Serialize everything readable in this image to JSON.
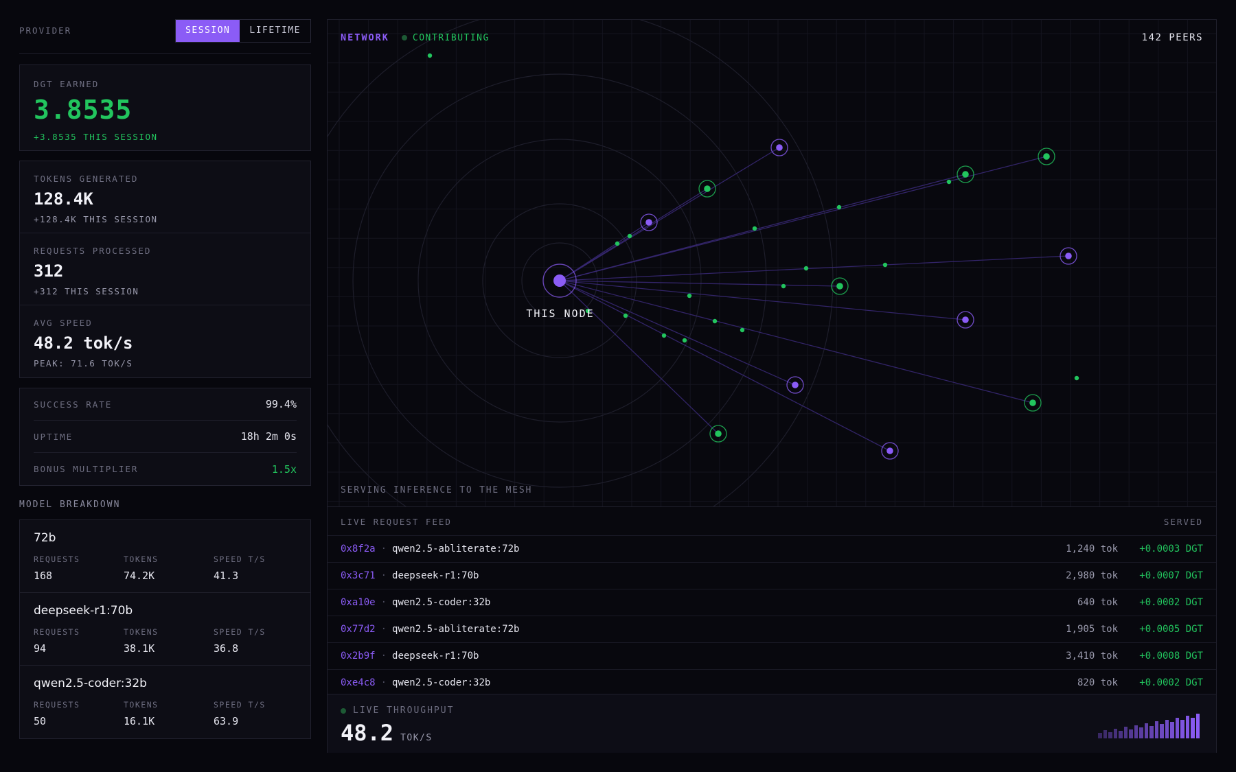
{
  "provider": {
    "label": "PROVIDER",
    "toggle": {
      "session": "SESSION",
      "lifetime": "LIFETIME"
    }
  },
  "earned": {
    "label": "DGT EARNED",
    "value": "3.8535",
    "session": "+3.8535 THIS SESSION"
  },
  "stats": [
    {
      "label": "TOKENS GENERATED",
      "value": "128.4K",
      "sub": "+128.4K THIS SESSION"
    },
    {
      "label": "REQUESTS PROCESSED",
      "value": "312",
      "sub": "+312 THIS SESSION"
    },
    {
      "label": "AVG SPEED",
      "value": "48.2 tok/s",
      "sub": "PEAK: 71.6 TOK/S"
    }
  ],
  "metrics": [
    {
      "label": "SUCCESS RATE",
      "value": "99.4%"
    },
    {
      "label": "UPTIME",
      "value": "18h 2m 0s"
    },
    {
      "label": "BONUS MULTIPLIER",
      "value": "1.5x"
    }
  ],
  "model_breakdown": {
    "title": "MODEL BREAKDOWN",
    "col_labels": {
      "requests": "REQUESTS",
      "tokens": "TOKENS",
      "speed": "SPEED T/S"
    },
    "models": [
      {
        "name": "72b",
        "requests": "168",
        "tokens": "74.2K",
        "speed": "41.3"
      },
      {
        "name": "deepseek-r1:70b",
        "requests": "94",
        "tokens": "38.1K",
        "speed": "36.8"
      },
      {
        "name": "qwen2.5-coder:32b",
        "requests": "50",
        "tokens": "16.1K",
        "speed": "63.9"
      }
    ]
  },
  "network": {
    "title": "NETWORK",
    "status": "CONTRIBUTING",
    "peers": "142 PEERS",
    "node_label": "THIS NODE",
    "footer": "SERVING INFERENCE TO THE MESH"
  },
  "feed": {
    "title": "LIVE REQUEST FEED",
    "served_label": "SERVED",
    "separator": "·",
    "rows": [
      {
        "id": "0x8f2a",
        "model": "qwen2.5-abliterate:72b",
        "tokens": "1,240 tok",
        "dgt": "+0.0003 DGT"
      },
      {
        "id": "0x3c71",
        "model": "deepseek-r1:70b",
        "tokens": "2,980 tok",
        "dgt": "+0.0007 DGT"
      },
      {
        "id": "0xa10e",
        "model": "qwen2.5-coder:32b",
        "tokens": "640 tok",
        "dgt": "+0.0002 DGT"
      },
      {
        "id": "0x77d2",
        "model": "qwen2.5-abliterate:72b",
        "tokens": "1,905 tok",
        "dgt": "+0.0005 DGT"
      },
      {
        "id": "0x2b9f",
        "model": "deepseek-r1:70b",
        "tokens": "3,410 tok",
        "dgt": "+0.0008 DGT"
      },
      {
        "id": "0xe4c8",
        "model": "qwen2.5-coder:32b",
        "tokens": "820 tok",
        "dgt": "+0.0002 DGT"
      }
    ]
  },
  "throughput": {
    "label": "LIVE THROUGHPUT",
    "value": "48.2",
    "unit": "TOK/S",
    "history": [
      0.22,
      0.32,
      0.25,
      0.38,
      0.3,
      0.45,
      0.35,
      0.5,
      0.42,
      0.58,
      0.48,
      0.65,
      0.55,
      0.72,
      0.62,
      0.8,
      0.7,
      0.88,
      0.78,
      0.95
    ]
  },
  "colors": {
    "accent": "#8b5cf6",
    "success": "#22c55e",
    "background": "#07070d"
  }
}
